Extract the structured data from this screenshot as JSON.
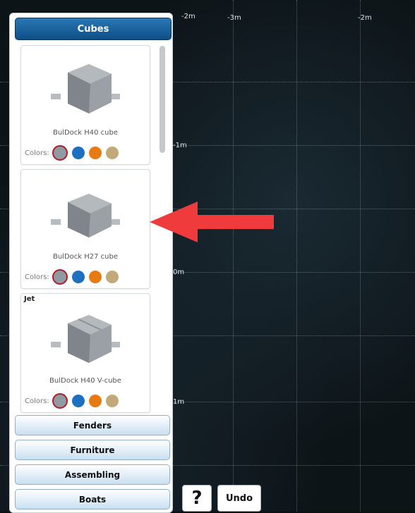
{
  "canvas": {
    "top_labels": [
      "-2m",
      "-3m",
      "-2m"
    ],
    "left_labels": [
      "-1m",
      "0m",
      "1m"
    ]
  },
  "sidebar": {
    "header": "Cubes",
    "products": [
      {
        "name": "BulDock H40 cube",
        "badge": "",
        "colors_label": "Colors:"
      },
      {
        "name": "BulDock H27 cube",
        "badge": "",
        "colors_label": "Colors:"
      },
      {
        "name": "BulDock H40 V-cube",
        "badge": "Jet",
        "colors_label": "Colors:"
      }
    ],
    "swatch_colors": [
      "#8f9aa3",
      "#1c6fc1",
      "#e87a12",
      "#c3a87a"
    ],
    "categories": [
      "Fenders",
      "Furniture",
      "Assembling",
      "Boats"
    ]
  },
  "toolbar": {
    "help_label": "?",
    "undo_label": "Undo"
  },
  "annotation": {
    "arrow_color": "#ef3b3b"
  }
}
